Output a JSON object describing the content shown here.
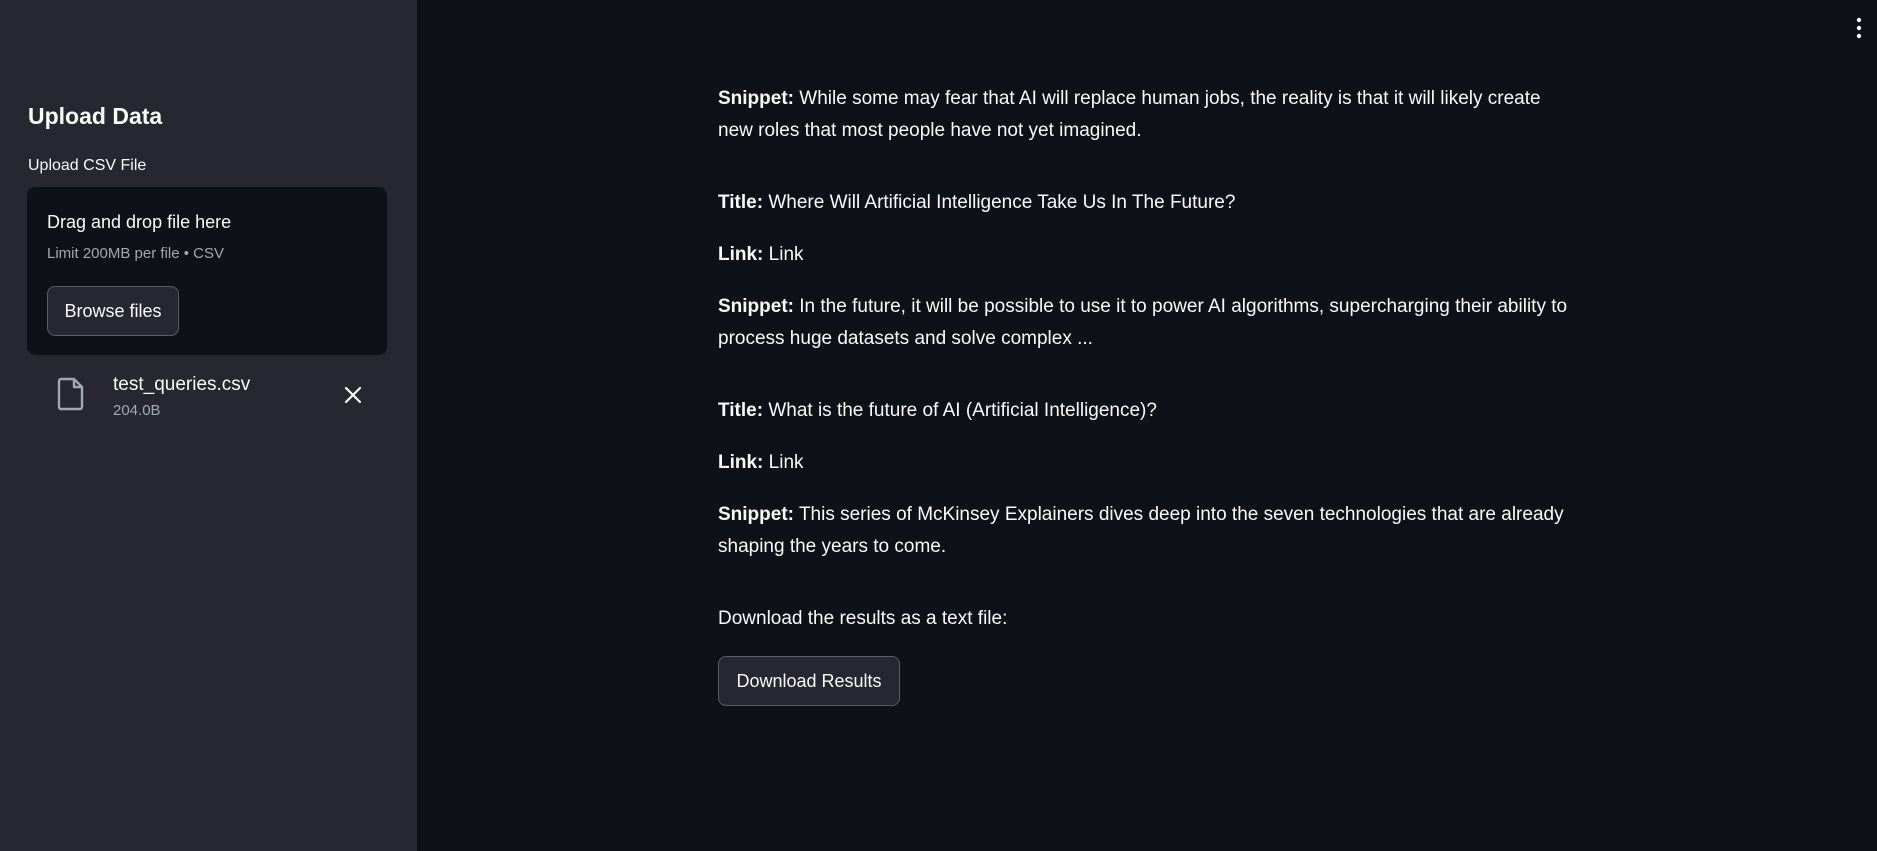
{
  "sidebar": {
    "header": "Upload Data",
    "uploader_label": "Upload CSV File",
    "dropzone": {
      "title": "Drag and drop file here",
      "limit": "Limit 200MB per file • CSV",
      "browse_label": "Browse files"
    },
    "file": {
      "name": "test_queries.csv",
      "size": "204.0B",
      "icon": "file-icon",
      "remove_icon": "close-icon"
    }
  },
  "header": {
    "menu_icon": "kebab-menu-icon"
  },
  "main": {
    "results": [
      {
        "snippet_label": "Snippet:",
        "snippet": "While some may fear that AI will replace human jobs, the reality is that it will likely create new roles that most people have not yet imagined."
      },
      {
        "title_label": "Title:",
        "title": "Where Will Artificial Intelligence Take Us In The Future?",
        "link_label": "Link:",
        "link": "Link",
        "snippet_label": "Snippet:",
        "snippet": "In the future, it will be possible to use it to power AI algorithms, supercharging their ability to process huge datasets and solve complex ..."
      },
      {
        "title_label": "Title:",
        "title": "What is the future of AI (Artificial Intelligence)?",
        "link_label": "Link:",
        "link": "Link",
        "snippet_label": "Snippet:",
        "snippet": "This series of McKinsey Explainers dives deep into the seven technologies that are already shaping the years to come."
      }
    ],
    "download_text": "Download the results as a text file:",
    "download_label": "Download Results"
  },
  "colors": {
    "background": "#0e1117",
    "sidebar": "#262730",
    "text": "#fafafa",
    "muted_text": "#a3a8b4"
  }
}
